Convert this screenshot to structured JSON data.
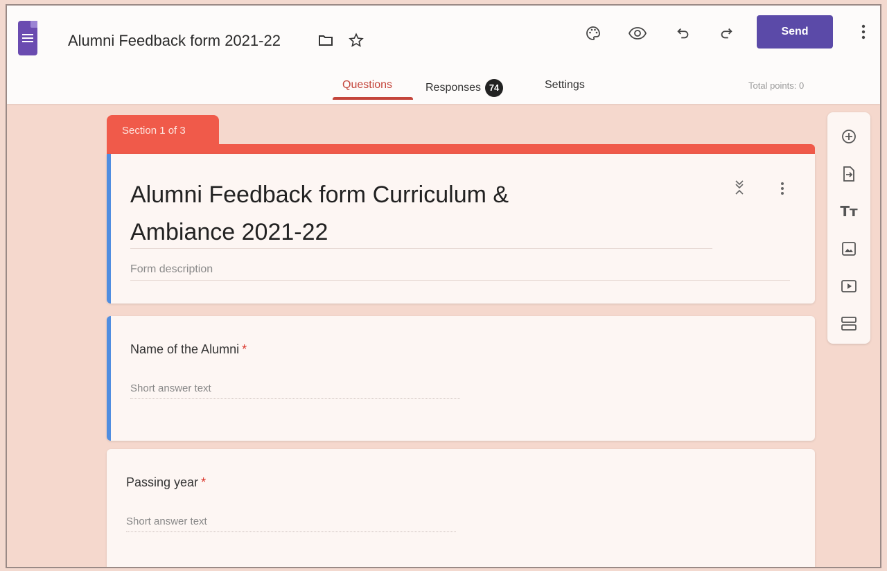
{
  "header": {
    "title": "Alumni Feedback form 2021-22",
    "send_label": "Send",
    "icons": [
      "palette-icon",
      "eye-icon",
      "undo-icon",
      "redo-icon",
      "more-vert-icon",
      "folder-icon",
      "star-icon"
    ]
  },
  "tabs": {
    "questions": "Questions",
    "responses": "Responses",
    "responses_count": "74",
    "settings": "Settings"
  },
  "total_points": "Total points: 0",
  "section": {
    "label": "Section 1 of 3",
    "form_title_line1": "Alumni Feedback form  Curriculum &",
    "form_title_line2": "Ambiance  2021-22",
    "description_placeholder": "Form description"
  },
  "questions": [
    {
      "label": "Name of the Alumni",
      "required": "*",
      "placeholder": "Short answer text"
    },
    {
      "label": "Passing year",
      "required": "*",
      "placeholder": "Short answer text"
    }
  ],
  "toolbar": {
    "items": [
      "add-question-icon",
      "import-questions-icon",
      "add-title-icon",
      "add-image-icon",
      "add-video-icon",
      "add-section-icon"
    ],
    "title_glyph": "Tт"
  },
  "colors": {
    "accent": "#5b4aa8",
    "section": "#f05a4a",
    "active_tab": "#c4453b",
    "card_accent": "#4f8de0"
  }
}
